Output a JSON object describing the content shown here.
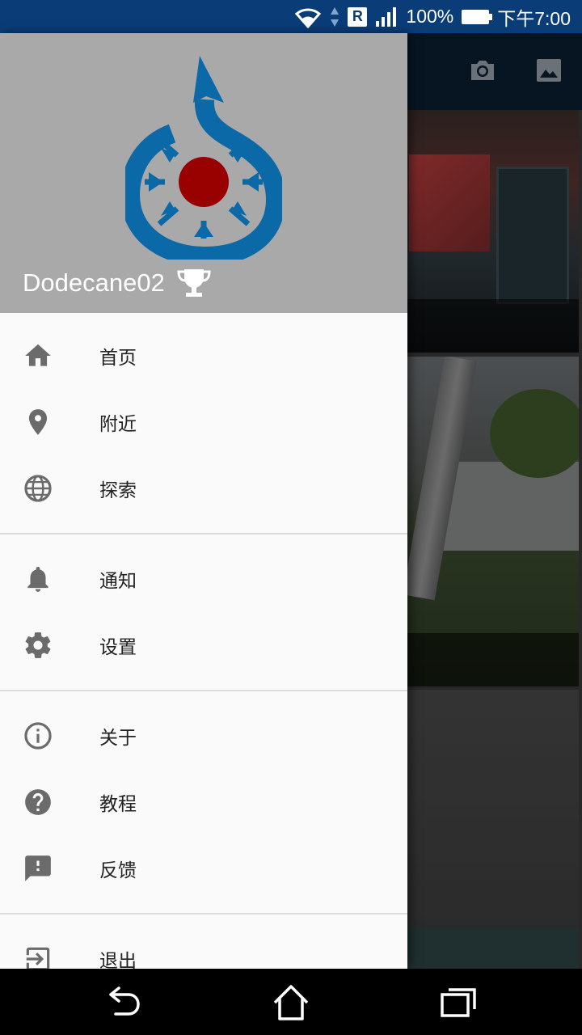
{
  "status_bar": {
    "battery": "100%",
    "time": "下午7:00",
    "roaming_badge": "R",
    "icons": [
      "wifi-icon",
      "data-activity-icon",
      "roaming-icon",
      "signal-icon",
      "battery-icon"
    ]
  },
  "background_app": {
    "toolbar_icons": [
      "camera-icon",
      "gallery-icon"
    ]
  },
  "drawer": {
    "username": "Dodecane02",
    "logo": "wikimedia-commons-logo",
    "achievement_icon": "trophy-icon",
    "groups": [
      [
        {
          "label": "首页",
          "icon": "home-icon"
        },
        {
          "label": "附近",
          "icon": "location-pin-icon"
        },
        {
          "label": "探索",
          "icon": "globe-icon"
        }
      ],
      [
        {
          "label": "通知",
          "icon": "bell-icon"
        },
        {
          "label": "设置",
          "icon": "gear-icon"
        }
      ],
      [
        {
          "label": "关于",
          "icon": "info-icon"
        },
        {
          "label": "教程",
          "icon": "help-icon"
        },
        {
          "label": "反馈",
          "icon": "feedback-icon"
        }
      ],
      [
        {
          "label": "退出",
          "icon": "logout-icon"
        }
      ]
    ]
  },
  "nav_bar": {
    "buttons": [
      "back-icon",
      "home-icon",
      "recents-icon"
    ]
  },
  "colors": {
    "status_bar": "#0a3d78",
    "drawer_header": "#a9a9a9",
    "logo_blue": "#0b69a8",
    "logo_red": "#990000",
    "menu_icon": "#6b6b6b"
  }
}
